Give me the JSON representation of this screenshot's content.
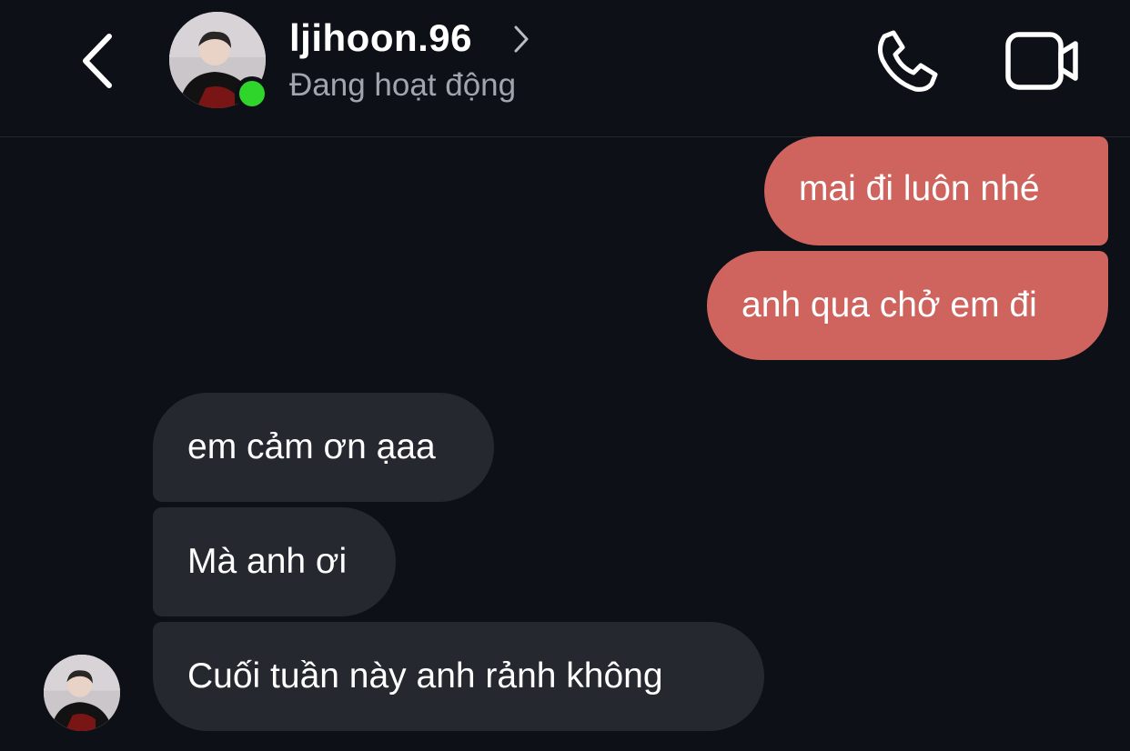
{
  "header": {
    "username": "ljihoon.96",
    "status": "Đang hoạt động",
    "back_icon": "chevron-left-icon",
    "phone_icon": "phone-icon",
    "video_icon": "video-camera-icon",
    "online_color": "#2fd52a"
  },
  "messages": [
    {
      "side": "outgoing",
      "text": "mai đi luôn nhé"
    },
    {
      "side": "outgoing",
      "text": "anh qua chở em đi"
    },
    {
      "side": "incoming",
      "text": "em cảm ơn ạaa"
    },
    {
      "side": "incoming",
      "text": "Mà anh ơi"
    },
    {
      "side": "incoming",
      "text": "Cuối tuần này anh rảnh không"
    }
  ],
  "colors": {
    "background": "#0d1016",
    "outgoing_bubble": "#cf645e",
    "incoming_bubble": "#25282e"
  }
}
